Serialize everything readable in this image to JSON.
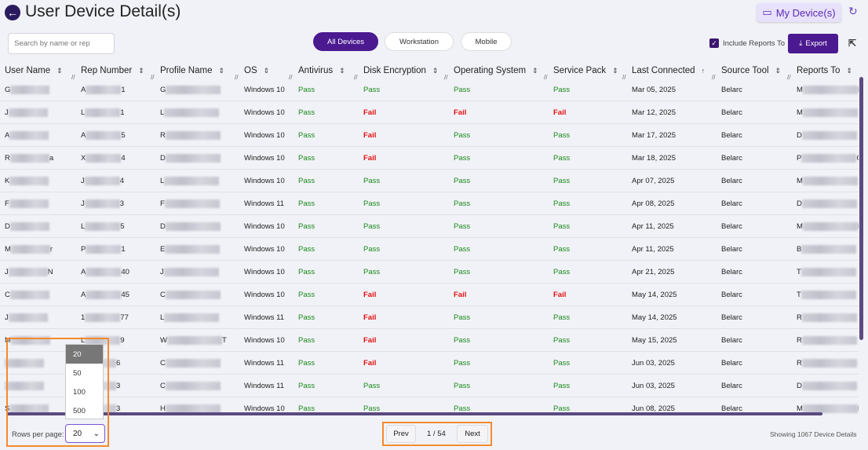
{
  "header": {
    "title": "User Device Detail(s)",
    "my_devices": "My Device(s)"
  },
  "toolbar": {
    "search_placeholder": "Search by name or rep",
    "filters": [
      "All Devices",
      "Workstation",
      "Mobile"
    ],
    "include_reports": "Include Reports To",
    "include_reports_checked": true,
    "export": "Export"
  },
  "columns": [
    "User Name",
    "Rep Number",
    "Profile Name",
    "OS",
    "Antivirus",
    "Disk Encryption",
    "Operating System",
    "Service Pack",
    "Last Connected",
    "Source Tool",
    "Reports To"
  ],
  "rows": [
    {
      "user": [
        "G",
        ""
      ],
      "rep": [
        "A",
        "1"
      ],
      "profile": [
        "G",
        ""
      ],
      "os": "Windows 10",
      "av": "Pass",
      "disk": "Pass",
      "opsys": "Pass",
      "sp": "Pass",
      "last": "Mar 05, 2025",
      "tool": "Belarc",
      "reports": [
        "M",
        "E"
      ]
    },
    {
      "user": [
        "J",
        ""
      ],
      "rep": [
        "L",
        "1"
      ],
      "profile": [
        "L",
        ""
      ],
      "os": "Windows 10",
      "av": "Pass",
      "disk": "Fail",
      "opsys": "Fail",
      "sp": "Fail",
      "last": "Mar 12, 2025",
      "tool": "Belarc",
      "reports": [
        "M",
        ""
      ]
    },
    {
      "user": [
        "A",
        ""
      ],
      "rep": [
        "A",
        "5"
      ],
      "profile": [
        "R",
        ""
      ],
      "os": "Windows 10",
      "av": "Pass",
      "disk": "Fail",
      "opsys": "Pass",
      "sp": "Pass",
      "last": "Mar 17, 2025",
      "tool": "Belarc",
      "reports": [
        "D",
        ""
      ]
    },
    {
      "user": [
        "R",
        "a"
      ],
      "rep": [
        "X",
        "4"
      ],
      "profile": [
        "D",
        ""
      ],
      "os": "Windows 10",
      "av": "Pass",
      "disk": "Fail",
      "opsys": "Pass",
      "sp": "Pass",
      "last": "Mar 18, 2025",
      "tool": "Belarc",
      "reports": [
        "P",
        "C"
      ]
    },
    {
      "user": [
        "K",
        ""
      ],
      "rep": [
        "J",
        "4"
      ],
      "profile": [
        "L",
        ""
      ],
      "os": "Windows 10",
      "av": "Pass",
      "disk": "Pass",
      "opsys": "Pass",
      "sp": "Pass",
      "last": "Apr 07, 2025",
      "tool": "Belarc",
      "reports": [
        "M",
        ""
      ]
    },
    {
      "user": [
        "F",
        ""
      ],
      "rep": [
        "J",
        "3"
      ],
      "profile": [
        "F",
        ""
      ],
      "os": "Windows 11",
      "av": "Pass",
      "disk": "Pass",
      "opsys": "Pass",
      "sp": "Pass",
      "last": "Apr 08, 2025",
      "tool": "Belarc",
      "reports": [
        "D",
        ""
      ]
    },
    {
      "user": [
        "D",
        ""
      ],
      "rep": [
        "L",
        "5"
      ],
      "profile": [
        "D",
        ""
      ],
      "os": "Windows 10",
      "av": "Pass",
      "disk": "Pass",
      "opsys": "Pass",
      "sp": "Pass",
      "last": "Apr 11, 2025",
      "tool": "Belarc",
      "reports": [
        "M",
        "E"
      ]
    },
    {
      "user": [
        "M",
        "r"
      ],
      "rep": [
        "P",
        "1"
      ],
      "profile": [
        "E",
        ""
      ],
      "os": "Windows 10",
      "av": "Pass",
      "disk": "Pass",
      "opsys": "Pass",
      "sp": "Pass",
      "last": "Apr 11, 2025",
      "tool": "Belarc",
      "reports": [
        "B",
        ""
      ]
    },
    {
      "user": [
        "J",
        "N"
      ],
      "rep": [
        "A",
        "40"
      ],
      "profile": [
        "J",
        ""
      ],
      "os": "Windows 10",
      "av": "Pass",
      "disk": "Pass",
      "opsys": "Pass",
      "sp": "Pass",
      "last": "Apr 21, 2025",
      "tool": "Belarc",
      "reports": [
        "T",
        ""
      ]
    },
    {
      "user": [
        "C",
        ""
      ],
      "rep": [
        "A",
        "45"
      ],
      "profile": [
        "C",
        ""
      ],
      "os": "Windows 10",
      "av": "Pass",
      "disk": "Fail",
      "opsys": "Fail",
      "sp": "Fail",
      "last": "May 14, 2025",
      "tool": "Belarc",
      "reports": [
        "T",
        ""
      ]
    },
    {
      "user": [
        "J",
        ""
      ],
      "rep": [
        "1",
        "77"
      ],
      "profile": [
        "L",
        ""
      ],
      "os": "Windows 11",
      "av": "Pass",
      "disk": "Fail",
      "opsys": "Pass",
      "sp": "Pass",
      "last": "May 14, 2025",
      "tool": "Belarc",
      "reports": [
        "R",
        ""
      ]
    },
    {
      "user": [
        "M",
        ""
      ],
      "rep": [
        "L",
        "9"
      ],
      "profile": [
        "W",
        "T"
      ],
      "os": "Windows 10",
      "av": "Pass",
      "disk": "Fail",
      "opsys": "Pass",
      "sp": "Pass",
      "last": "May 15, 2025",
      "tool": "Belarc",
      "reports": [
        "R",
        ""
      ]
    },
    {
      "user": [
        "",
        ""
      ],
      "rep": [
        "",
        "6"
      ],
      "profile": [
        "C",
        ""
      ],
      "os": "Windows 11",
      "av": "Pass",
      "disk": "Fail",
      "opsys": "Pass",
      "sp": "Pass",
      "last": "Jun 03, 2025",
      "tool": "Belarc",
      "reports": [
        "R",
        ""
      ]
    },
    {
      "user": [
        "",
        ""
      ],
      "rep": [
        "",
        "3"
      ],
      "profile": [
        "C",
        ""
      ],
      "os": "Windows 11",
      "av": "Pass",
      "disk": "Pass",
      "opsys": "Pass",
      "sp": "Pass",
      "last": "Jun 03, 2025",
      "tool": "Belarc",
      "reports": [
        "D",
        ""
      ]
    },
    {
      "user": [
        "S",
        ""
      ],
      "rep": [
        "",
        "3"
      ],
      "profile": [
        "H",
        ""
      ],
      "os": "Windows 10",
      "av": "Pass",
      "disk": "Pass",
      "opsys": "Pass",
      "sp": "Pass",
      "last": "Jun 08, 2025",
      "tool": "Belarc",
      "reports": [
        "M",
        "E"
      ]
    }
  ],
  "pagination": {
    "rows_label": "Rows per page:",
    "rows_value": "20",
    "rows_options": [
      "20",
      "50",
      "100",
      "500"
    ],
    "prev": "Prev",
    "page": "1 / 54",
    "next": "Next",
    "showing": "Showing 1067 Device Details"
  },
  "colors": {
    "accent": "#4b1a91",
    "pass": "#1a8a1a",
    "fail": "#e01010",
    "highlight": "#f58a2e"
  }
}
